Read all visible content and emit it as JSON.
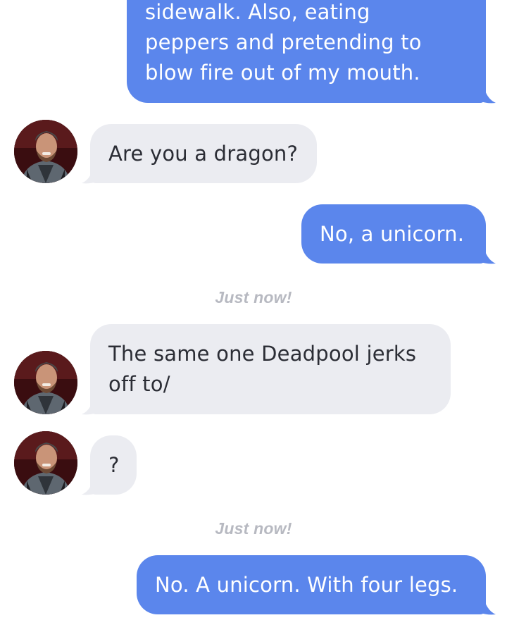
{
  "conversation": {
    "messages": [
      {
        "sender": "me",
        "lines": [
          "sidewalk. Also, eating",
          "peppers and pretending to",
          "blow fire out of my mouth."
        ]
      },
      {
        "sender": "them",
        "lines": [
          "Are you a dragon?"
        ]
      },
      {
        "sender": "me",
        "lines": [
          "No, a unicorn."
        ]
      },
      {
        "sender": "them",
        "lines": [
          "The same one Deadpool jerks",
          "off to/"
        ]
      },
      {
        "sender": "them",
        "lines": [
          "?"
        ]
      },
      {
        "sender": "me",
        "lines": [
          "No. A unicorn. With four legs."
        ]
      }
    ],
    "timestamps": [
      "Just now!",
      "Just now!"
    ]
  },
  "colors": {
    "outgoing_bubble": "#5b86ec",
    "incoming_bubble": "#ebecf1",
    "timestamp_text": "#b7b9c1"
  },
  "icons": {
    "avatar": "profile-photo"
  }
}
